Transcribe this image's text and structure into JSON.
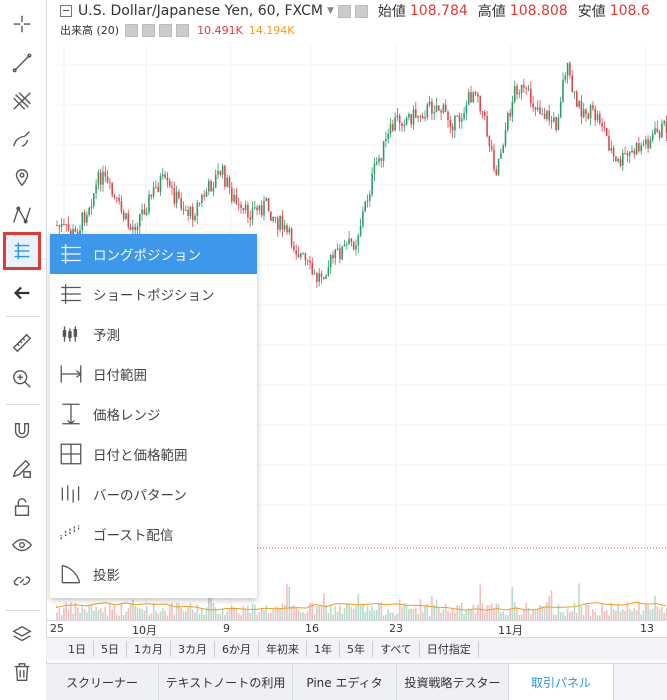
{
  "header": {
    "symbol": "U.S. Dollar/Japanese Yen, 60, FXCM",
    "open_label": "始値",
    "open_value": "108.784",
    "high_label": "高値",
    "high_value": "108.808",
    "low_label": "安値",
    "low_value": "108.6"
  },
  "volume": {
    "label": "出来高 (20)",
    "v1": "10.491K",
    "v2": "14.194K"
  },
  "menu": [
    {
      "label": "ロングポジション",
      "icon": "long-position-icon"
    },
    {
      "label": "ショートポジション",
      "icon": "short-position-icon"
    },
    {
      "label": "予測",
      "icon": "forecast-icon"
    },
    {
      "label": "日付範囲",
      "icon": "date-range-icon"
    },
    {
      "label": "価格レンジ",
      "icon": "price-range-icon"
    },
    {
      "label": "日付と価格範囲",
      "icon": "date-price-range-icon"
    },
    {
      "label": "バーのパターン",
      "icon": "bars-pattern-icon"
    },
    {
      "label": "ゴースト配信",
      "icon": "ghost-feed-icon"
    },
    {
      "label": "投影",
      "icon": "projection-icon"
    }
  ],
  "xaxis": [
    "25",
    "10月",
    "9",
    "16",
    "23",
    "11月",
    "13"
  ],
  "timeframes": [
    "1日",
    "5日",
    "1カ月",
    "3カ月",
    "6か月",
    "年初来",
    "1年",
    "5年",
    "すべて",
    "日付指定"
  ],
  "tabs": [
    "スクリーナー",
    "テキストノートの利用",
    "Pine エディタ",
    "投資戦略テスター",
    "取引パネル"
  ],
  "colors": {
    "up": "#2e9c6a",
    "down": "#e0464a",
    "accent": "#2196f3",
    "menu_active": "#3d97ea"
  }
}
